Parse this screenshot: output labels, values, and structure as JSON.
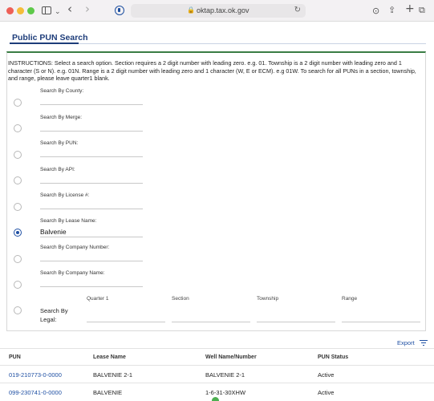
{
  "browser": {
    "url": "oktap.tax.ok.gov"
  },
  "page": {
    "title": "Public PUN Search",
    "instructions": "INSTRUCTIONS: Select a search option. Section requires a 2 digit number with leading zero. e.g. 01. Township is a 2 digit number with leading zero and 1 character (S or N). e.g. 01N. Range is a 2 digit number with leading zero and 1 character (W, E or ECM). e.g 01W. To search for all PUNs in a section, township, and range, please leave quarter1 blank."
  },
  "search_options": [
    {
      "label": "Search By County:",
      "value": "",
      "selected": false
    },
    {
      "label": "Search By Merge:",
      "value": "",
      "selected": false
    },
    {
      "label": "Search By PUN:",
      "value": "",
      "selected": false
    },
    {
      "label": "Search By API:",
      "value": "",
      "selected": false
    },
    {
      "label": "Search By License #:",
      "value": "",
      "selected": false
    },
    {
      "label": "Search By Lease Name:",
      "value": "Balvenie",
      "selected": true
    },
    {
      "label": "Search By Company Number:",
      "value": "",
      "selected": false
    },
    {
      "label": "Search By Company Name:",
      "value": "",
      "selected": false
    }
  ],
  "legal": {
    "label": "Search By Legal:",
    "fields": [
      "Quarter 1",
      "Section",
      "Township",
      "Range"
    ]
  },
  "results": {
    "export_label": "Export",
    "columns": [
      "PUN",
      "Lease Name",
      "Well Name/Number",
      "PUN Status"
    ],
    "rows": [
      [
        "019-210773-0-0000",
        "BALVENIE 2-1",
        "BALVENIE 2-1",
        "Active"
      ],
      [
        "099-230741-0-0000",
        "BALVENIE",
        "1-6-31-30XHW",
        "Active"
      ]
    ]
  }
}
